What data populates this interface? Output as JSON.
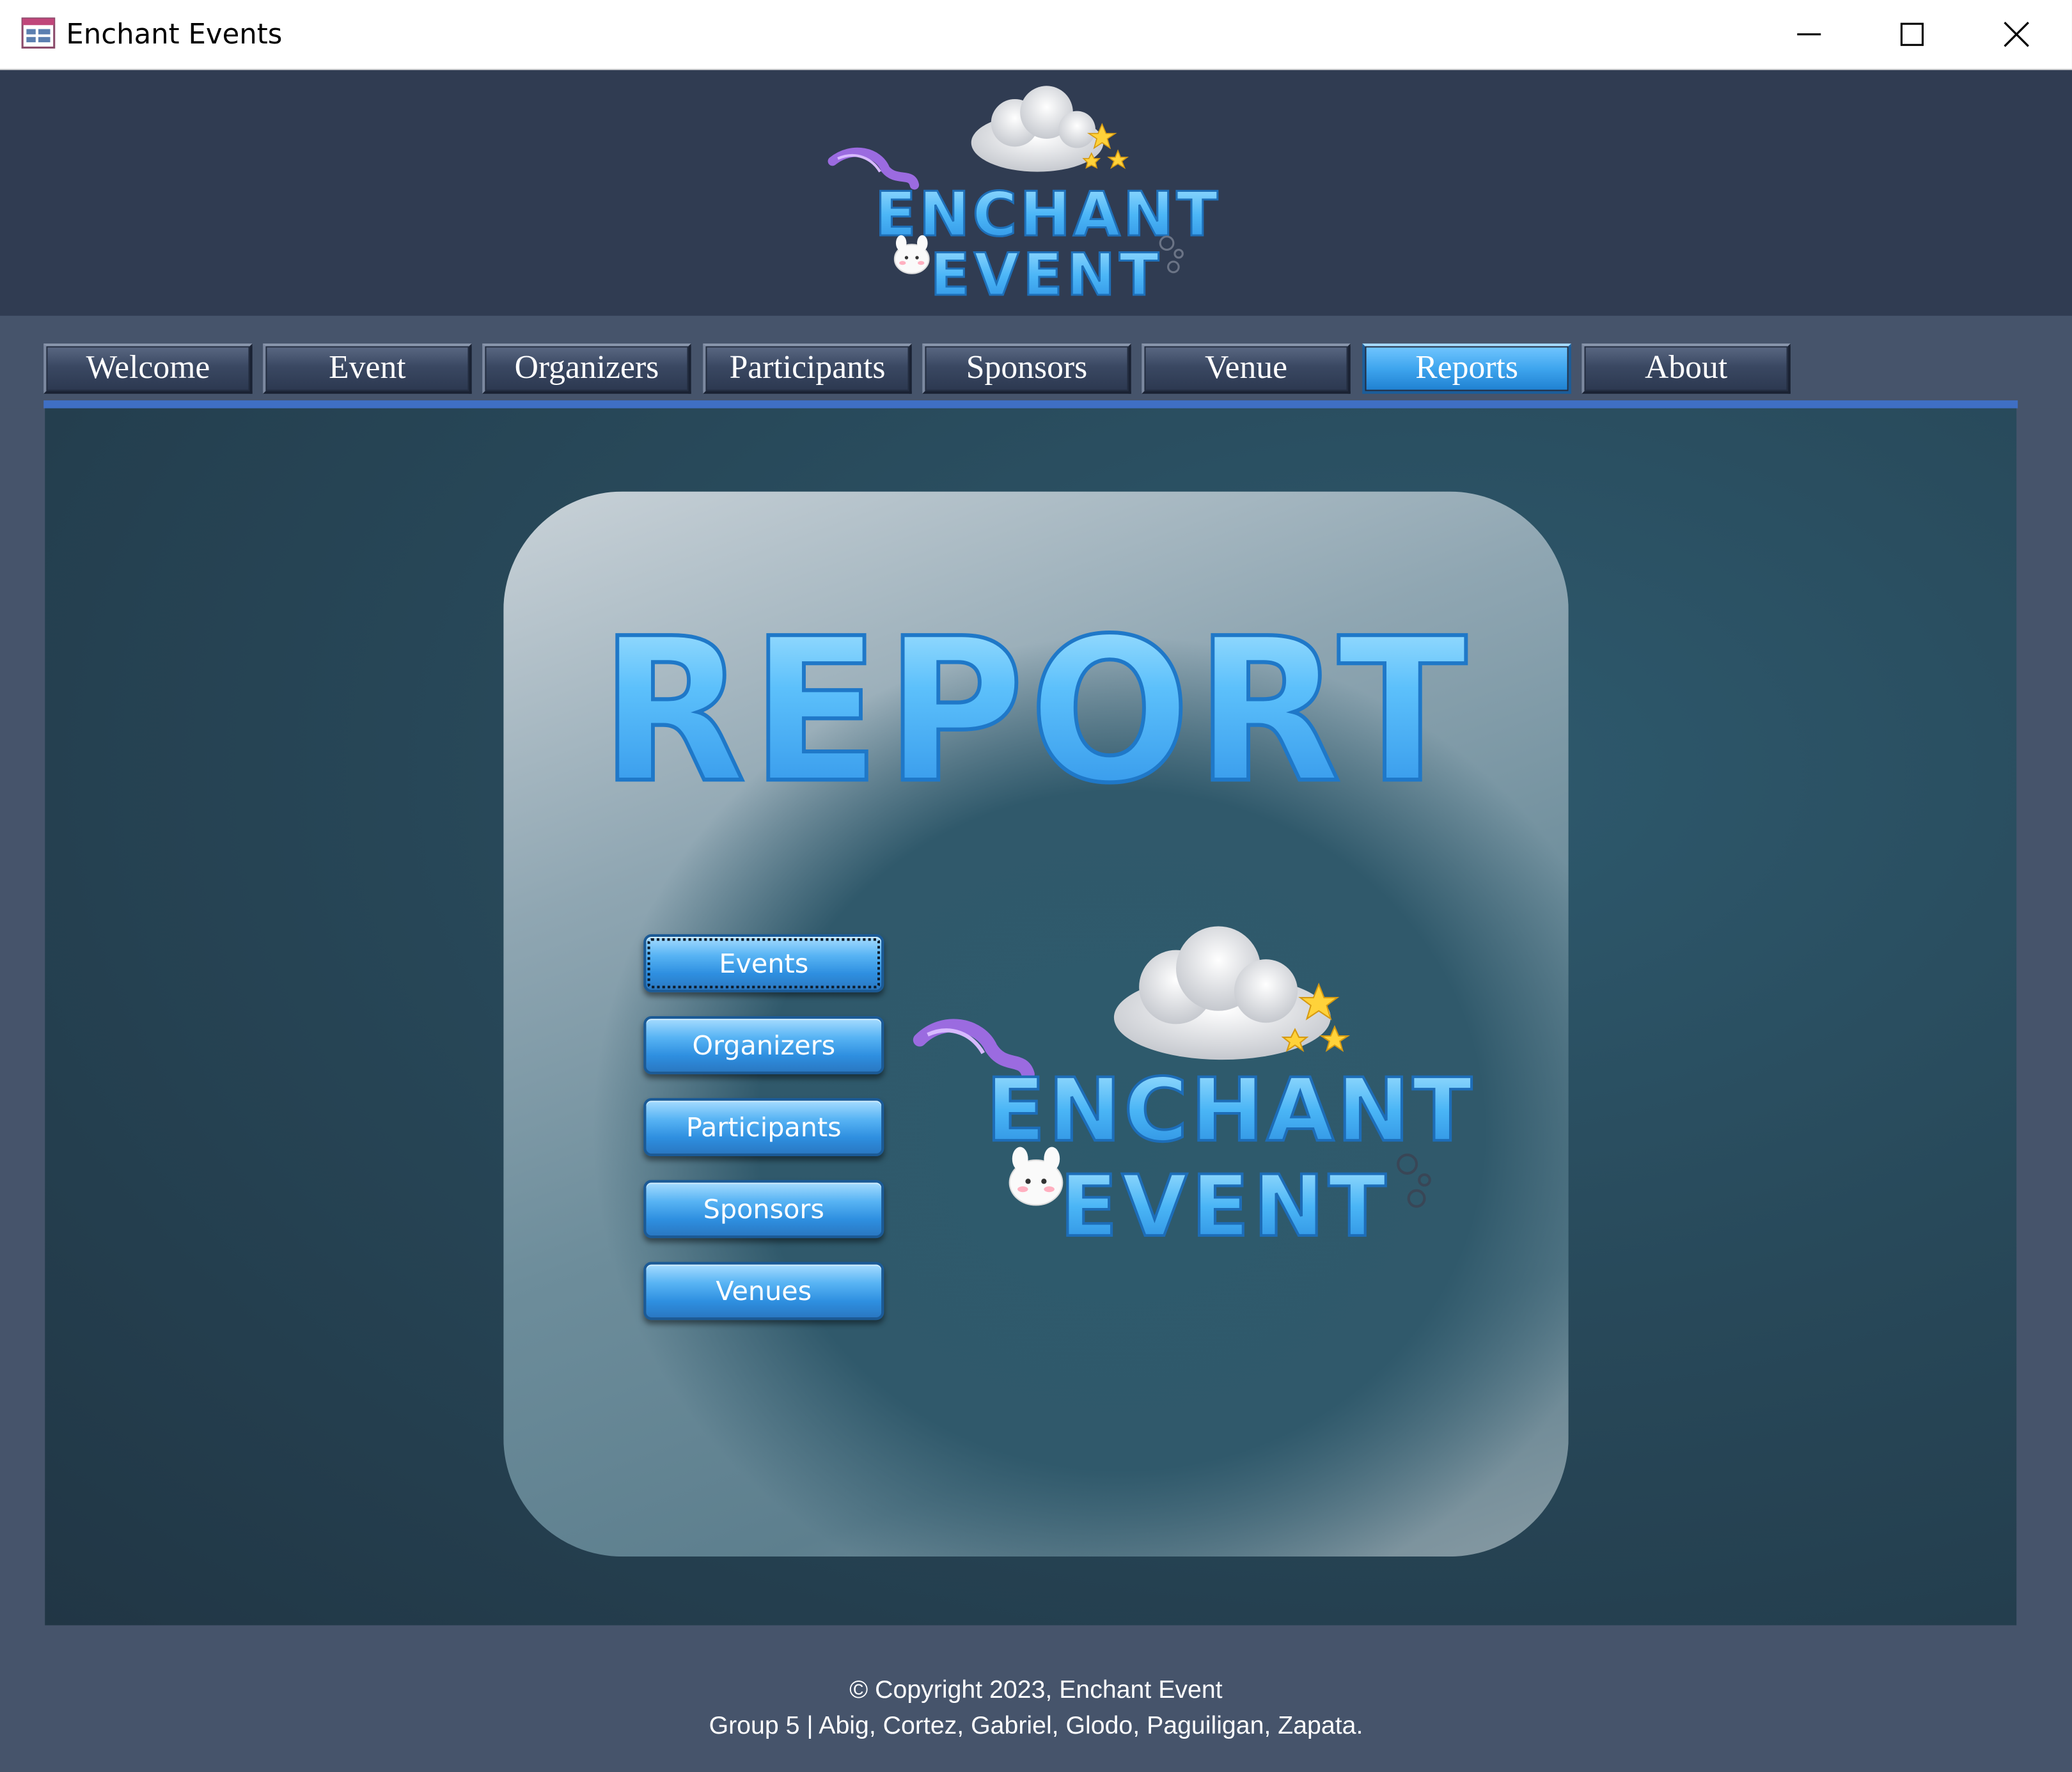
{
  "window": {
    "title": "Enchant Events"
  },
  "brand": {
    "logo_line1": "ENCHANT",
    "logo_line2": "EVENT"
  },
  "tabs": [
    {
      "label": "Welcome"
    },
    {
      "label": "Event"
    },
    {
      "label": "Organizers"
    },
    {
      "label": "Participants"
    },
    {
      "label": "Sponsors"
    },
    {
      "label": "Venue"
    },
    {
      "label": "Reports",
      "active": true
    },
    {
      "label": "About"
    }
  ],
  "page": {
    "heading": "REPORT"
  },
  "report_buttons": [
    {
      "label": "Events",
      "focused": true
    },
    {
      "label": "Organizers"
    },
    {
      "label": "Participants"
    },
    {
      "label": "Sponsors"
    },
    {
      "label": "Venues"
    }
  ],
  "footer": {
    "copyright": "© Copyright 2023, Enchant Event",
    "credits": "Group 5 | Abig, Cortez, Gabriel, Glodo, Paguiligan, Zapata."
  },
  "colors": {
    "accent": "#3ea5ee",
    "header_bg": "#303c52",
    "frame_bg": "#46546b"
  },
  "icons": [
    "app-form-icon",
    "minimize-icon",
    "maximize-icon",
    "close-icon",
    "cloud-icon",
    "star-icon",
    "bunny-icon"
  ]
}
